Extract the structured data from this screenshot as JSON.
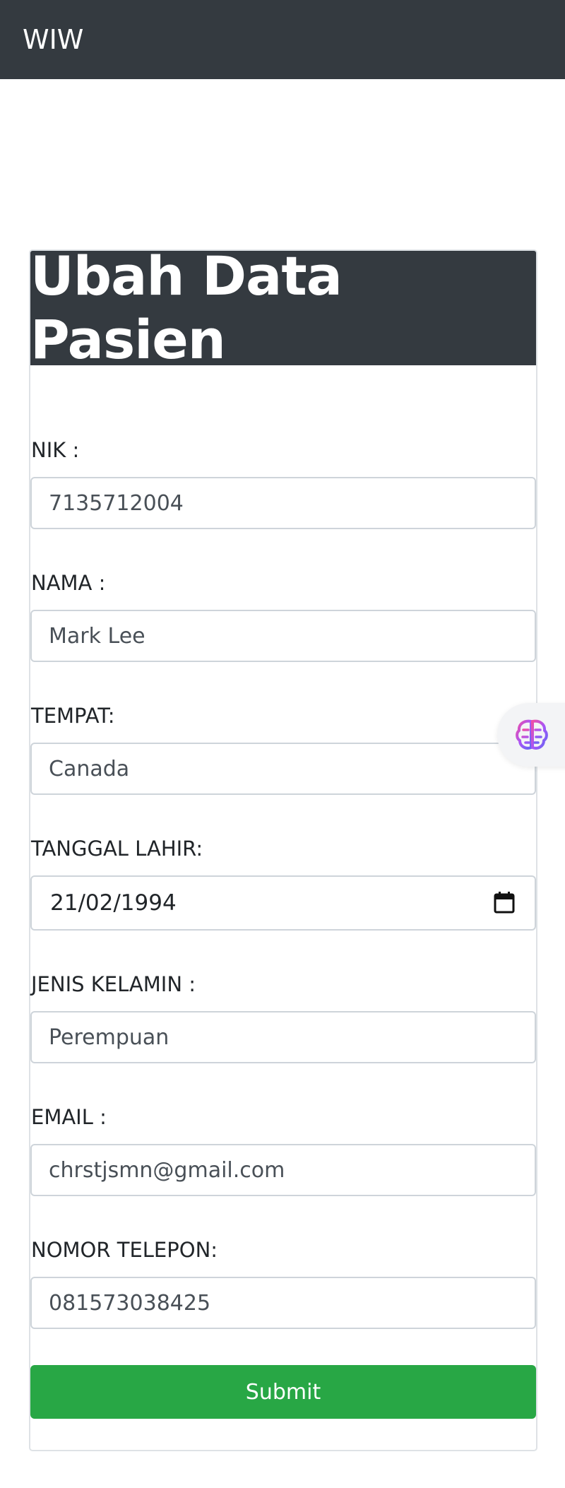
{
  "navbar": {
    "brand": "WIW"
  },
  "card": {
    "title": "Ubah Data Pasien"
  },
  "form": {
    "nik": {
      "label": "NIK :",
      "value": "7135712004"
    },
    "nama": {
      "label": "NAMA :",
      "value": "Mark Lee"
    },
    "tempat": {
      "label": "TEMPAT:",
      "value": "Canada"
    },
    "tanggal_lahir": {
      "label": "TANGGAL LAHIR:",
      "value": "21/02/1994",
      "icon": "calendar-icon"
    },
    "jenis_kelamin": {
      "label": "JENIS KELAMIN :",
      "value": "Perempuan"
    },
    "email": {
      "label": "EMAIL :",
      "value": "chrstjsmn@gmail.com"
    },
    "nomor_telepon": {
      "label": "NOMOR TELEPON:",
      "value": "081573038425"
    },
    "submit_label": "Submit"
  },
  "floating_widget": {
    "icon": "brain-icon"
  },
  "colors": {
    "navbar": "#343a40",
    "submit": "#28a745",
    "input_border": "#ced4da"
  }
}
